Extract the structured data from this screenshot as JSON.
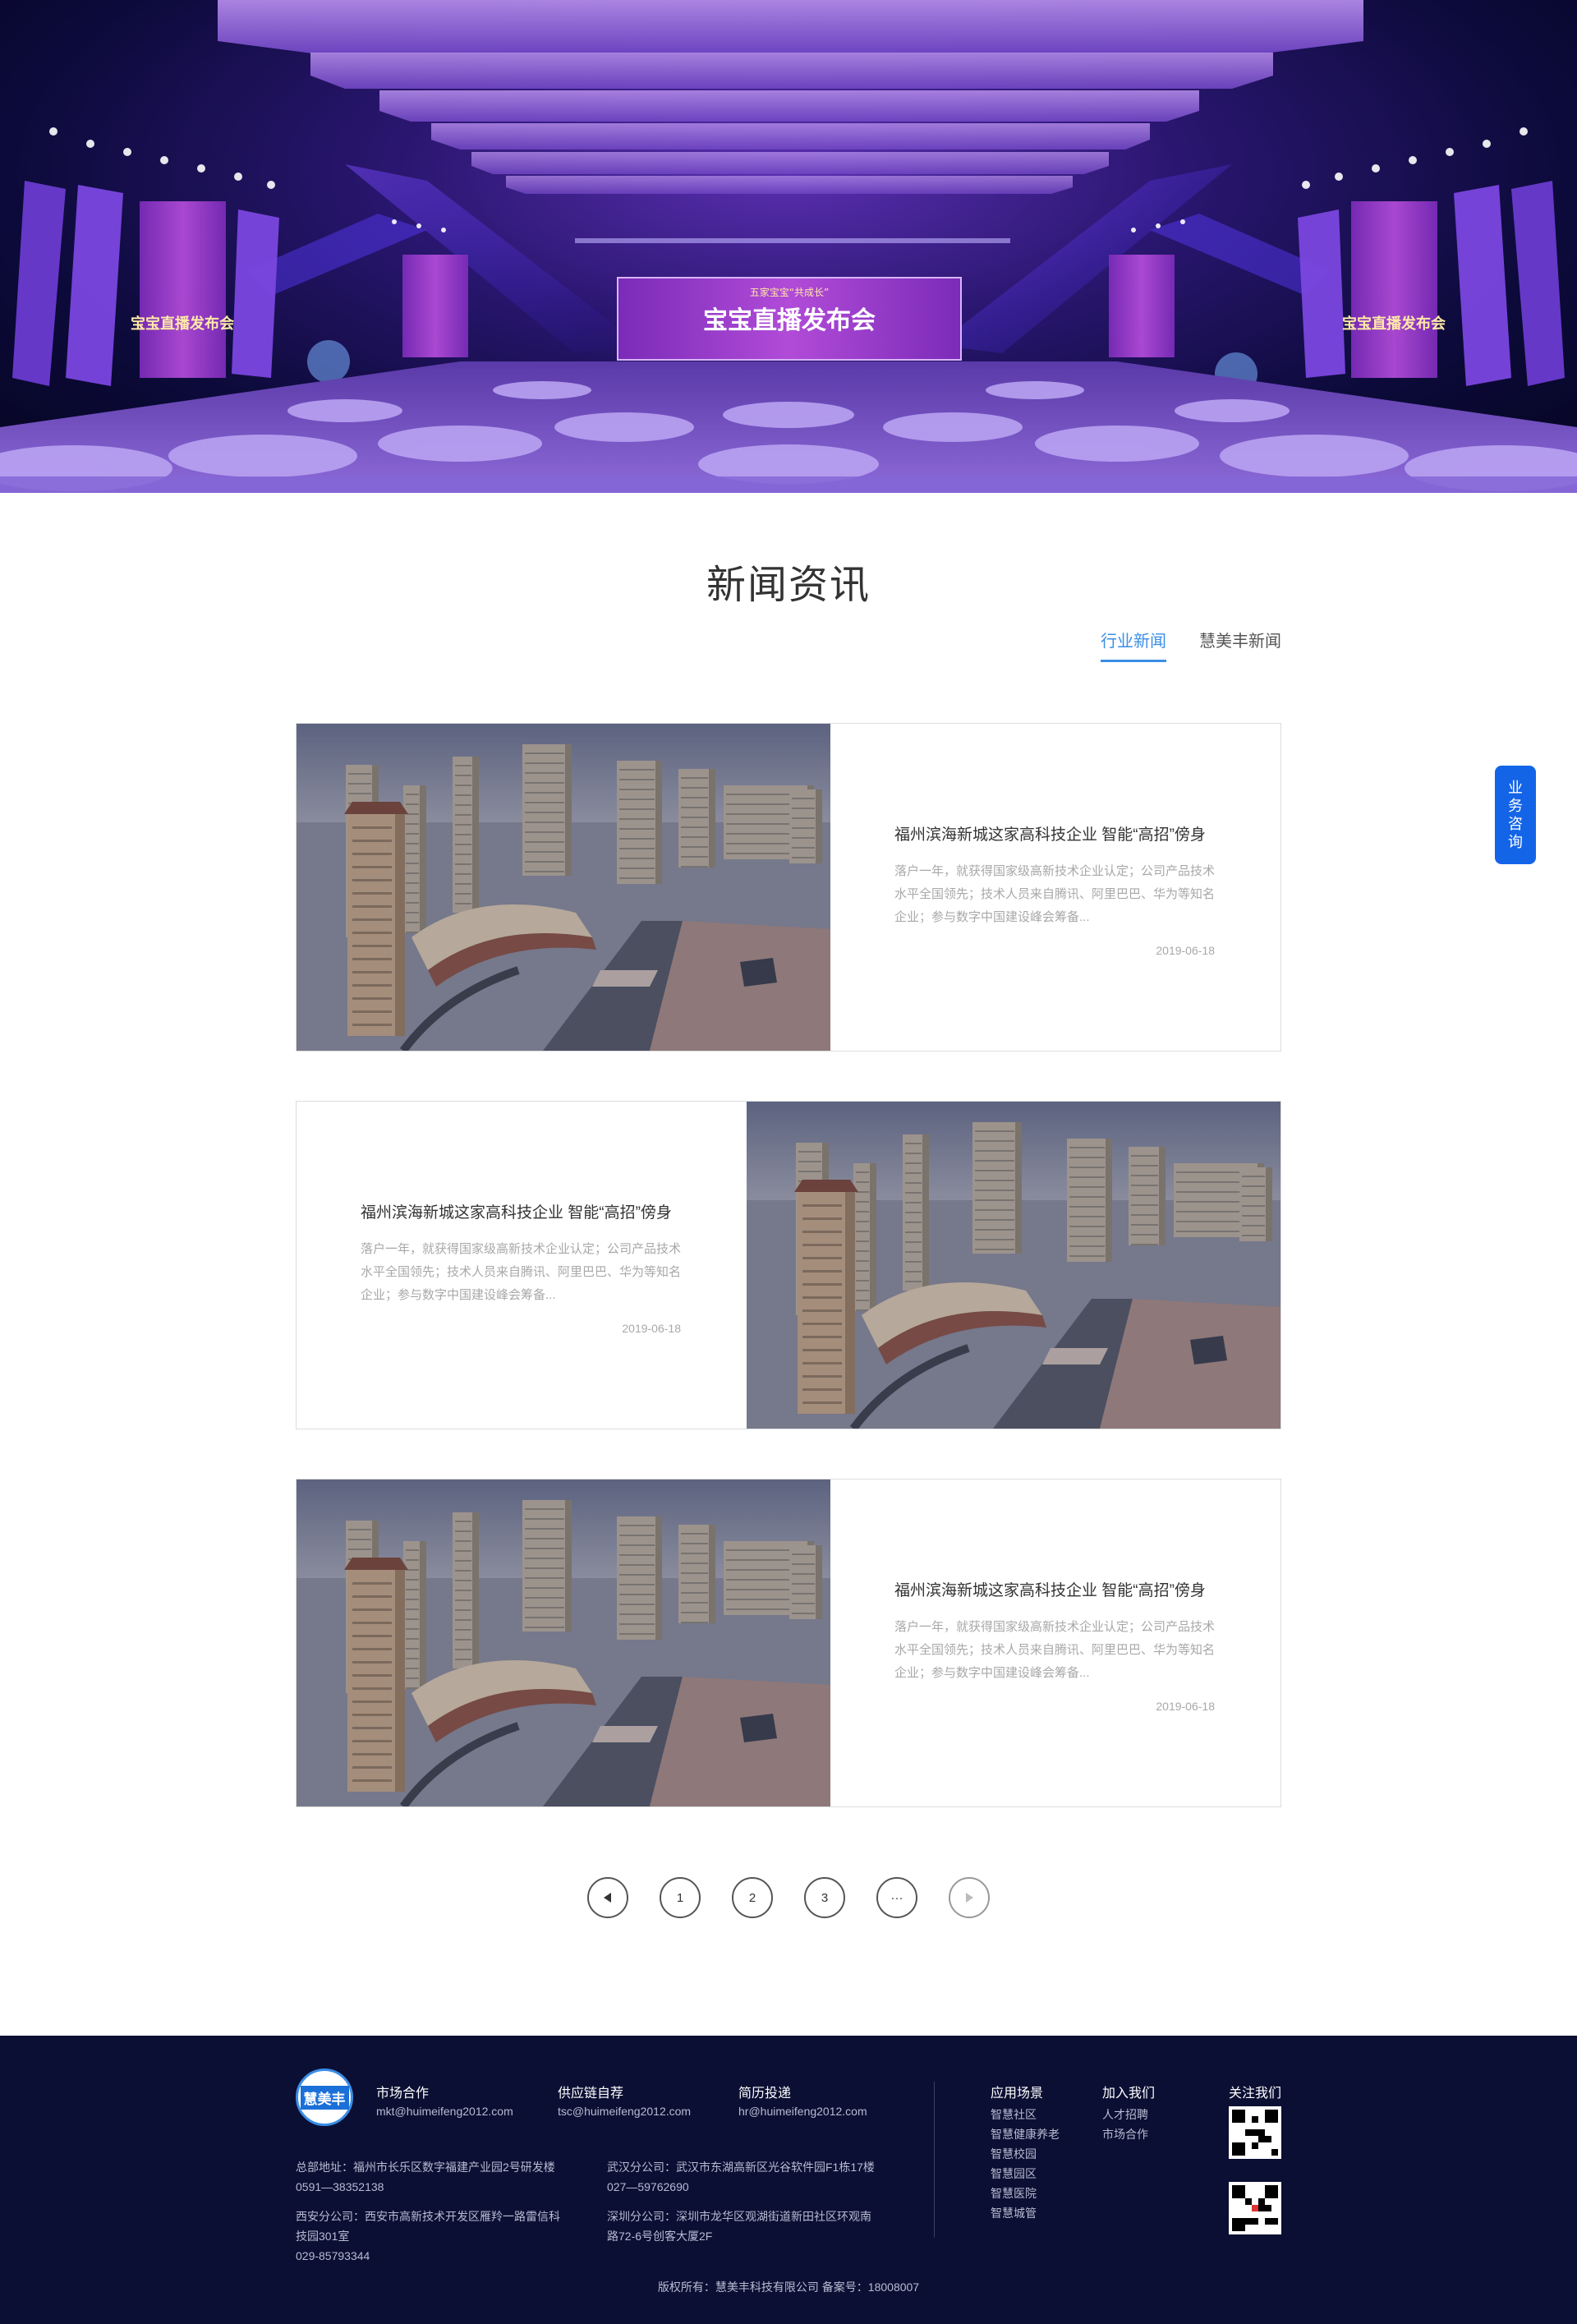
{
  "hero": {
    "banner_small": "五家宝宝“共成长”",
    "banner_main": "宝宝直播发布会",
    "side_screen_text": "宝宝直播发布会"
  },
  "news": {
    "title": "新闻资讯",
    "tabs": [
      {
        "label": "行业新闻",
        "active": true
      },
      {
        "label": "慧美丰新闻",
        "active": false
      }
    ],
    "articles": [
      {
        "title": "福州滨海新城这家高科技企业 智能“高招”傍身",
        "summary": "落户一年，就获得国家级高新技术企业认定；公司产品技术水平全国领先；技术人员来自腾讯、阿里巴巴、华为等知名企业；参与数字中国建设峰会筹备...",
        "date": "2019-06-18"
      },
      {
        "title": "福州滨海新城这家高科技企业 智能“高招”傍身",
        "summary": "落户一年，就获得国家级高新技术企业认定；公司产品技术水平全国领先；技术人员来自腾讯、阿里巴巴、华为等知名企业；参与数字中国建设峰会筹备...",
        "date": "2019-06-18"
      },
      {
        "title": "福州滨海新城这家高科技企业 智能“高招”傍身",
        "summary": "落户一年，就获得国家级高新技术企业认定；公司产品技术水平全国领先；技术人员来自腾讯、阿里巴巴、华为等知名企业；参与数字中国建设峰会筹备...",
        "date": "2019-06-18"
      }
    ]
  },
  "pagination": {
    "prev_icon": "triangle-left-icon",
    "pages": [
      "1",
      "2",
      "3",
      "···"
    ],
    "next_icon": "triangle-right-icon"
  },
  "consult": {
    "label": "业务咨询"
  },
  "footer": {
    "logo_text": "慧美丰",
    "contacts": [
      {
        "title": "市场合作",
        "email": "mkt@huimeifeng2012.com"
      },
      {
        "title": "供应链自荐",
        "email": "tsc@huimeifeng2012.com"
      },
      {
        "title": "简历投递",
        "email": "hr@huimeifeng2012.com"
      }
    ],
    "addresses": [
      {
        "line1": "总部地址：福州市长乐区数字福建产业园2号研发楼",
        "line2": "0591—38352138"
      },
      {
        "line1": "武汉分公司：武汉市东湖高新区光谷软件园F1栋17楼",
        "line2": "027—59762690"
      },
      {
        "line1": "西安分公司：西安市高新技术开发区雁羚一路雷信科",
        "line2": "技园301室",
        "line3": "029-85793344"
      },
      {
        "line1": "深圳分公司：深圳市龙华区观湖街道新田社区环观南",
        "line2": "路72-6号创客大厦2F"
      }
    ],
    "scenes": {
      "title": "应用场景",
      "items": [
        "智慧社区",
        "智慧健康养老",
        "智慧校园",
        "智慧园区",
        "智慧医院",
        "智慧城管"
      ]
    },
    "join": {
      "title": "加入我们",
      "items": [
        "人才招聘",
        "市场合作"
      ]
    },
    "follow": {
      "title": "关注我们"
    },
    "copyright": "版权所有：慧美丰科技有限公司 备案号：18008007"
  }
}
